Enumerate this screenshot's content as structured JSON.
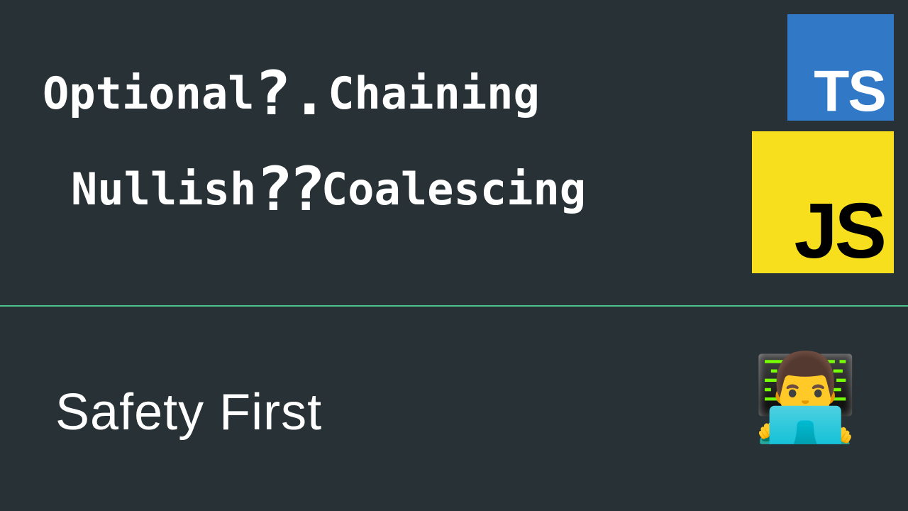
{
  "line1": {
    "word1": "Optional",
    "operator": "?.",
    "word2": "Chaining"
  },
  "line2": {
    "word1": "Nullish",
    "operator": "??",
    "word2": "Coalescing"
  },
  "subtitle": "Safety First",
  "badges": {
    "ts": "TS",
    "js": "JS"
  },
  "avatar_emoji": "👨‍💻",
  "colors": {
    "background": "#273136",
    "divider": "#4ec28b",
    "ts_bg": "#3178c6",
    "js_bg": "#f7df1e",
    "text": "#ffffff"
  }
}
